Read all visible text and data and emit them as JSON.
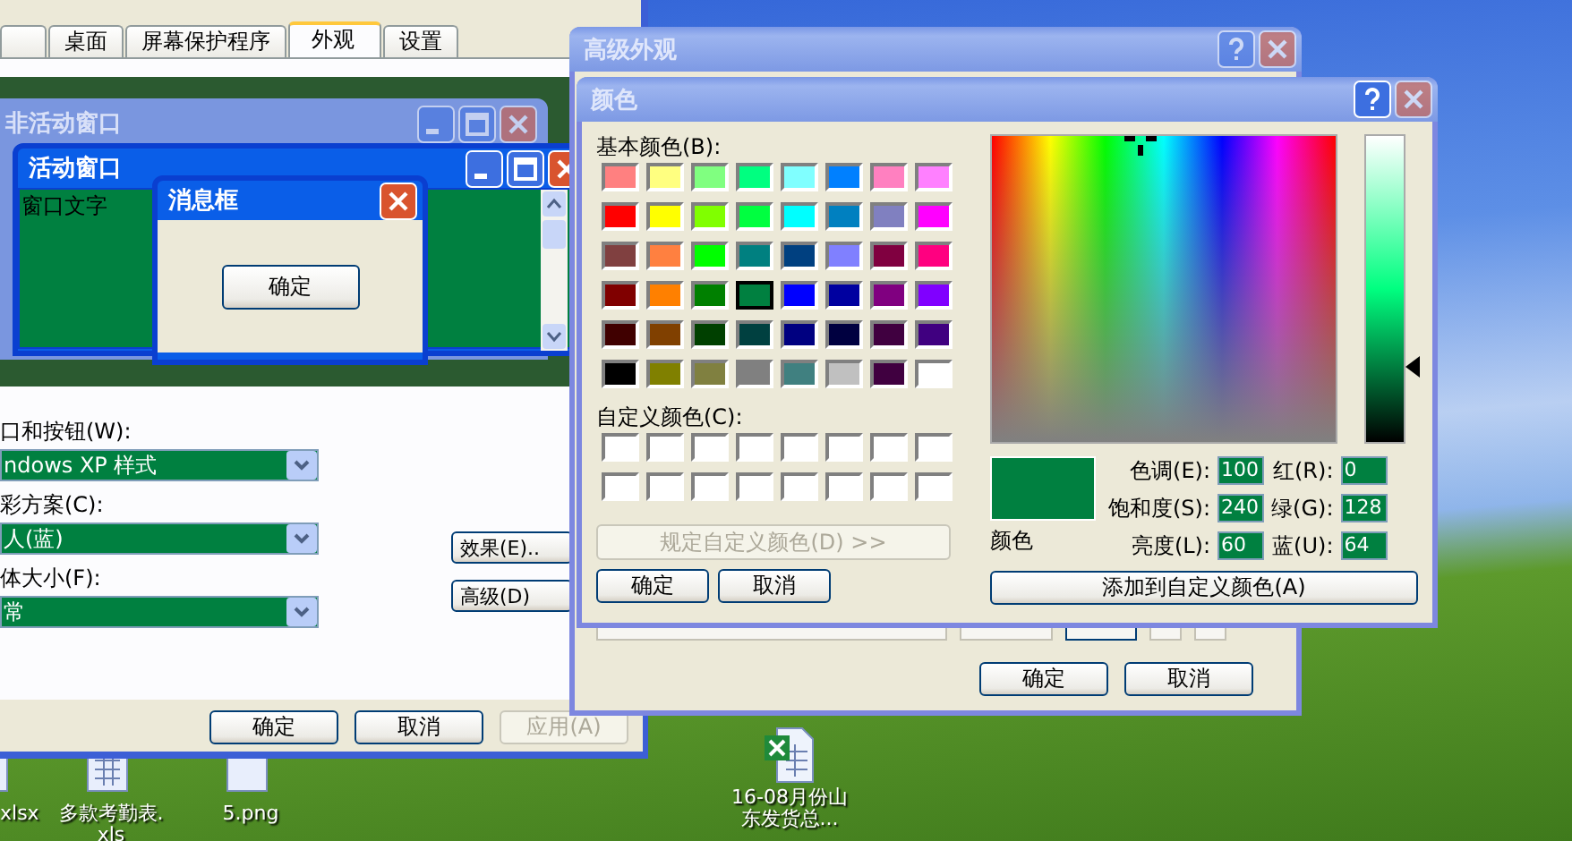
{
  "desktop": {
    "icons": [
      {
        "kind": "file",
        "lines": [
          "xlsx"
        ]
      },
      {
        "kind": "sheet",
        "lines": [
          "多款考勤表.",
          "xls"
        ]
      },
      {
        "kind": "image",
        "lines": [
          "5.png"
        ]
      },
      {
        "kind": "excel",
        "lines": [
          "16-08月份山",
          "东发货总..."
        ]
      }
    ]
  },
  "display_properties": {
    "tabs": [
      {
        "label": "桌面",
        "selected": false
      },
      {
        "label": "屏幕保护程序",
        "selected": false
      },
      {
        "label": "外观",
        "selected": true
      },
      {
        "label": "设置",
        "selected": false
      }
    ],
    "preview": {
      "inactive_window": {
        "title": "非活动窗口"
      },
      "active_window": {
        "title": "活动窗口",
        "text": "窗口文字"
      },
      "message_box": {
        "title": "消息框",
        "button": "确定"
      }
    },
    "fields": [
      {
        "label": "口和按钮(W):",
        "value": "ndows XP 样式"
      },
      {
        "label": "彩方案(C):",
        "value": "人(蓝)"
      },
      {
        "label": "体大小(F):",
        "value": "常"
      }
    ],
    "side_buttons": [
      "效果(E)..",
      "高级(D)"
    ],
    "buttons": [
      {
        "label": "确定",
        "disabled": false
      },
      {
        "label": "取消",
        "disabled": false
      },
      {
        "label": "应用(A)",
        "disabled": true
      }
    ]
  },
  "advanced_appearance": {
    "title": "高级外观",
    "buttons": [
      "确定",
      "取消"
    ]
  },
  "color_dialog": {
    "title": "颜色",
    "basic_label": "基本颜色(B):",
    "basic_colors": [
      {
        "color": "#ff8080",
        "selected": false
      },
      {
        "color": "#ffff80",
        "selected": false
      },
      {
        "color": "#80ff80",
        "selected": false
      },
      {
        "color": "#00ff80",
        "selected": false
      },
      {
        "color": "#80ffff",
        "selected": false
      },
      {
        "color": "#0080ff",
        "selected": false
      },
      {
        "color": "#ff80c0",
        "selected": false
      },
      {
        "color": "#ff80ff",
        "selected": false
      },
      {
        "color": "#ff0000",
        "selected": false
      },
      {
        "color": "#ffff00",
        "selected": false
      },
      {
        "color": "#80ff00",
        "selected": false
      },
      {
        "color": "#00ff40",
        "selected": false
      },
      {
        "color": "#00ffff",
        "selected": false
      },
      {
        "color": "#0080c0",
        "selected": false
      },
      {
        "color": "#8080c0",
        "selected": false
      },
      {
        "color": "#ff00ff",
        "selected": false
      },
      {
        "color": "#804040",
        "selected": false
      },
      {
        "color": "#ff8040",
        "selected": false
      },
      {
        "color": "#00ff00",
        "selected": false
      },
      {
        "color": "#008080",
        "selected": false
      },
      {
        "color": "#004080",
        "selected": false
      },
      {
        "color": "#8080ff",
        "selected": false
      },
      {
        "color": "#800040",
        "selected": false
      },
      {
        "color": "#ff0080",
        "selected": false
      },
      {
        "color": "#800000",
        "selected": false
      },
      {
        "color": "#ff8000",
        "selected": false
      },
      {
        "color": "#008000",
        "selected": false
      },
      {
        "color": "#008040",
        "selected": true
      },
      {
        "color": "#0000ff",
        "selected": false
      },
      {
        "color": "#0000a0",
        "selected": false
      },
      {
        "color": "#800080",
        "selected": false
      },
      {
        "color": "#8000ff",
        "selected": false
      },
      {
        "color": "#400000",
        "selected": false
      },
      {
        "color": "#804000",
        "selected": false
      },
      {
        "color": "#004000",
        "selected": false
      },
      {
        "color": "#004040",
        "selected": false
      },
      {
        "color": "#000080",
        "selected": false
      },
      {
        "color": "#000040",
        "selected": false
      },
      {
        "color": "#400040",
        "selected": false
      },
      {
        "color": "#400080",
        "selected": false
      },
      {
        "color": "#000000",
        "selected": false
      },
      {
        "color": "#808000",
        "selected": false
      },
      {
        "color": "#808040",
        "selected": false
      },
      {
        "color": "#808080",
        "selected": false
      },
      {
        "color": "#408080",
        "selected": false
      },
      {
        "color": "#c0c0c0",
        "selected": false
      },
      {
        "color": "#400040",
        "selected": false
      },
      {
        "color": "#ffffff",
        "selected": false
      }
    ],
    "custom_label": "自定义颜色(C):",
    "custom_colors": [
      {
        "color": "#ffffff"
      },
      {
        "color": "#ffffff"
      },
      {
        "color": "#ffffff"
      },
      {
        "color": "#ffffff"
      },
      {
        "color": "#ffffff"
      },
      {
        "color": "#ffffff"
      },
      {
        "color": "#ffffff"
      },
      {
        "color": "#ffffff"
      },
      {
        "color": "#ffffff"
      },
      {
        "color": "#ffffff"
      },
      {
        "color": "#ffffff"
      },
      {
        "color": "#ffffff"
      },
      {
        "color": "#ffffff"
      },
      {
        "color": "#ffffff"
      },
      {
        "color": "#ffffff"
      },
      {
        "color": "#ffffff"
      }
    ],
    "define_button": {
      "label": "规定自定义颜色(D) >>",
      "disabled": true
    },
    "buttons": [
      "确定",
      "取消"
    ],
    "luminance": {
      "level": 0.25
    },
    "preview_label": "颜色",
    "fields": [
      {
        "label": "色调(E):",
        "value": "100"
      },
      {
        "label": "红(R):",
        "value": "0"
      },
      {
        "label": "饱和度(S):",
        "value": "240"
      },
      {
        "label": "绿(G):",
        "value": "128"
      },
      {
        "label": "亮度(L):",
        "value": "60"
      },
      {
        "label": "蓝(U):",
        "value": "64"
      }
    ],
    "add_button": "添加到自定义颜色(A)"
  }
}
